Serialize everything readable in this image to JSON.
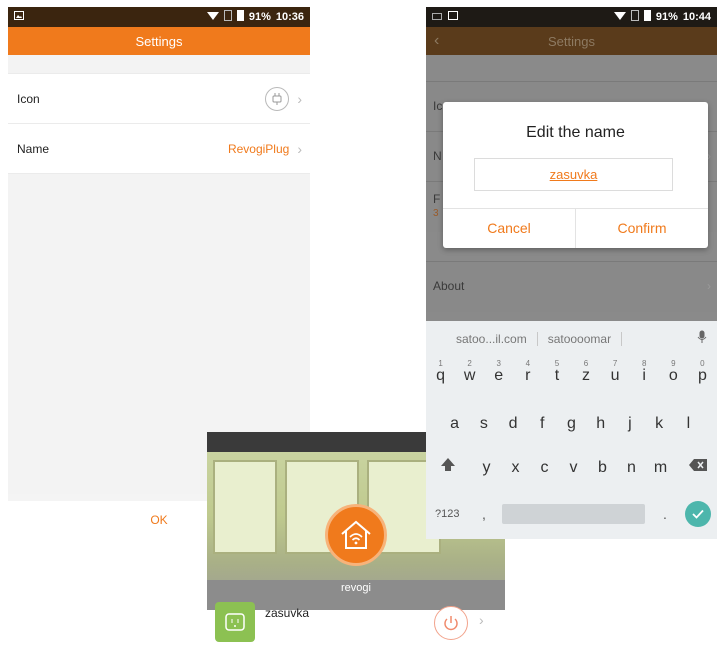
{
  "screen1": {
    "status": {
      "battery": "91%",
      "time": "10:36"
    },
    "title": "Settings",
    "rows": [
      {
        "label": "Icon",
        "value": ""
      },
      {
        "label": "Name",
        "value": "RevogiPlug"
      }
    ],
    "ok_label": "OK"
  },
  "screen2": {
    "status": {
      "battery": "91%",
      "time": "10:44"
    },
    "title": "Settings",
    "bg_rows": [
      {
        "label": "Ic"
      },
      {
        "label": "N"
      },
      {
        "label": "F",
        "sub": "3"
      },
      {
        "label": "About"
      }
    ],
    "dialog": {
      "title": "Edit the name",
      "input_value": "zasuvka",
      "cancel_label": "Cancel",
      "confirm_label": "Confirm"
    },
    "keyboard": {
      "suggestions": [
        "satoo...il.com",
        "satoooomar"
      ],
      "row1": [
        "q",
        "w",
        "e",
        "r",
        "t",
        "z",
        "u",
        "i",
        "o",
        "p"
      ],
      "row1_hints": [
        "1",
        "2",
        "3",
        "4",
        "5",
        "6",
        "7",
        "8",
        "9",
        "0"
      ],
      "row2": [
        "a",
        "s",
        "d",
        "f",
        "g",
        "h",
        "j",
        "k",
        "l"
      ],
      "row3": [
        "y",
        "x",
        "c",
        "v",
        "b",
        "n",
        "m"
      ],
      "symbols_key": "?123",
      "comma_key": ",",
      "period_key": "."
    }
  },
  "screen3": {
    "brand": "revogi",
    "device_name": "zasuvka"
  },
  "colors": {
    "accent": "#f07a1c",
    "status_bar": "#3b250f",
    "device_green": "#8cc152",
    "enter_teal": "#4db6ac"
  }
}
